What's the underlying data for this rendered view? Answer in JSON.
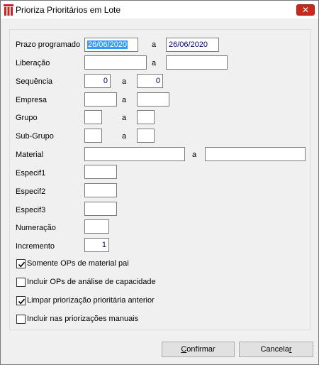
{
  "window": {
    "title": "Prioriza Prioritários em Lote",
    "close_glyph": "✕"
  },
  "form": {
    "prazo": {
      "label": "Prazo programado",
      "from": "26/06/2020",
      "sep": "a",
      "to": "26/06/2020"
    },
    "liberacao": {
      "label": "Liberação",
      "from": "",
      "sep": "a",
      "to": ""
    },
    "sequencia": {
      "label": "Sequência",
      "from": "0",
      "sep": "a",
      "to": "0"
    },
    "empresa": {
      "label": "Empresa",
      "from": "",
      "sep": "a",
      "to": ""
    },
    "grupo": {
      "label": "Grupo",
      "from": "",
      "sep": "a",
      "to": ""
    },
    "subgrupo": {
      "label": "Sub-Grupo",
      "from": "",
      "sep": "a",
      "to": ""
    },
    "material": {
      "label": "Material",
      "from": "",
      "sep": "a",
      "to": ""
    },
    "especif1": {
      "label": "Especif1",
      "value": ""
    },
    "especif2": {
      "label": "Especif2",
      "value": ""
    },
    "especif3": {
      "label": "Especif3",
      "value": ""
    },
    "numeracao": {
      "label": "Numeração",
      "value": ""
    },
    "incremento": {
      "label": "Incremento",
      "value": "1"
    }
  },
  "options": [
    {
      "label": "Somente OPs de material pai",
      "checked": true
    },
    {
      "label": "Incluir OPs de análise de capacidade",
      "checked": false
    },
    {
      "label": "Limpar priorização prioritária anterior",
      "checked": true
    },
    {
      "label": "Incluir nas priorizações manuais",
      "checked": false
    }
  ],
  "buttons": {
    "confirm_first": "C",
    "confirm_rest": "onfirmar",
    "cancel_first": "Cancela",
    "cancel_last": "r"
  }
}
